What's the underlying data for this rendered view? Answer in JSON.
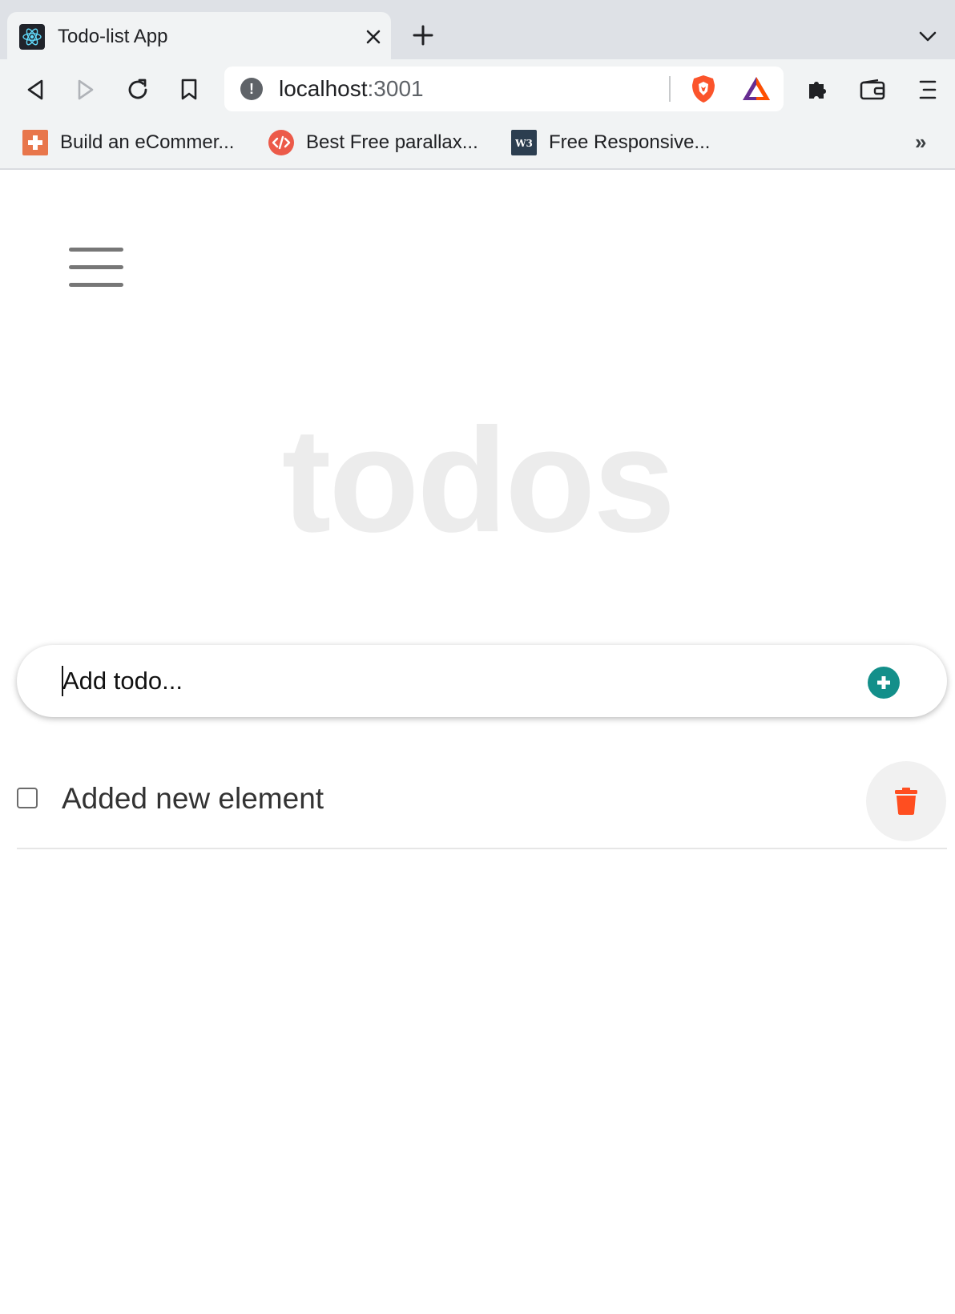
{
  "browser": {
    "tab": {
      "title": "Todo-list App",
      "favicon": "react-icon"
    },
    "address": {
      "host": "localhost",
      "port": ":3001"
    },
    "bookmarks": [
      {
        "label": "Build an eCommer...",
        "icon": "bookmark-plus-icon"
      },
      {
        "label": "Best Free parallax...",
        "icon": "code-icon"
      },
      {
        "label": "Free Responsive...",
        "icon": "w3-icon"
      }
    ],
    "bookmarks_more": "»"
  },
  "page": {
    "title": "todos",
    "add_todo": {
      "value": "",
      "placeholder": "Add todo..."
    },
    "todos": [
      {
        "text": "Added new element",
        "completed": false
      }
    ]
  },
  "colors": {
    "accent": "#138f8a",
    "delete": "#ff4e20",
    "title": "#ececec"
  }
}
